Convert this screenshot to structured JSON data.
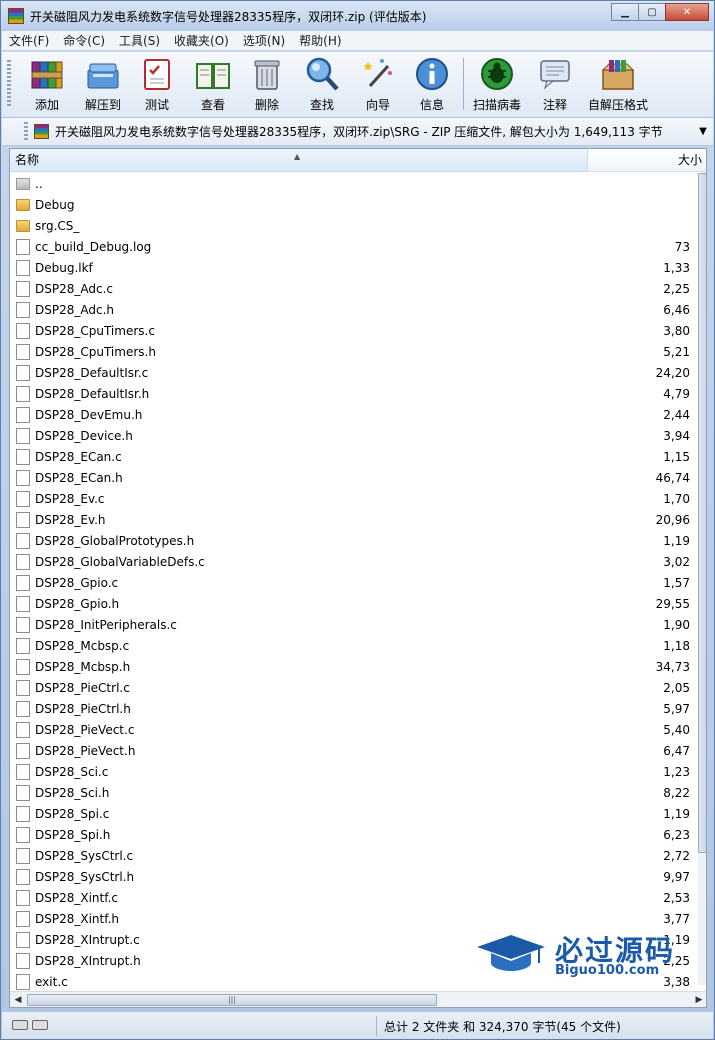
{
  "window": {
    "title": "开关磁阻风力发电系统数字信号处理器28335程序，双闭环.zip (评估版本)",
    "buttons": [
      "▁",
      "▢",
      "✕"
    ]
  },
  "menu": [
    "文件(F)",
    "命令(C)",
    "工具(S)",
    "收藏夹(O)",
    "选项(N)",
    "帮助(H)"
  ],
  "toolbar": [
    {
      "label": "添加",
      "icon": "add-archive-icon"
    },
    {
      "label": "解压到",
      "icon": "extract-to-icon"
    },
    {
      "label": "测试",
      "icon": "test-icon"
    },
    {
      "label": "查看",
      "icon": "view-icon"
    },
    {
      "label": "删除",
      "icon": "trash-icon"
    },
    {
      "label": "查找",
      "icon": "find-icon"
    },
    {
      "label": "向导",
      "icon": "wizard-icon"
    },
    {
      "label": "信息",
      "icon": "info-icon"
    },
    {
      "label": "扫描病毒",
      "icon": "virus-scan-icon"
    },
    {
      "label": "注释",
      "icon": "comment-icon"
    },
    {
      "label": "自解压格式",
      "icon": "sfx-icon"
    }
  ],
  "pathbar": {
    "text": "开关磁阻风力发电系统数字信号处理器28335程序，双闭环.zip\\SRG - ZIP 压缩文件, 解包大小为 1,649,113 字节"
  },
  "columns": {
    "name": "名称",
    "size": "大小"
  },
  "files": [
    {
      "name": "..",
      "size": "",
      "type": "up"
    },
    {
      "name": "Debug",
      "size": "",
      "type": "folder"
    },
    {
      "name": "srg.CS_",
      "size": "",
      "type": "folder"
    },
    {
      "name": "cc_build_Debug.log",
      "size": "73",
      "type": "file"
    },
    {
      "name": "Debug.lkf",
      "size": "1,33",
      "type": "file"
    },
    {
      "name": "DSP28_Adc.c",
      "size": "2,25",
      "type": "file"
    },
    {
      "name": "DSP28_Adc.h",
      "size": "6,46",
      "type": "file"
    },
    {
      "name": "DSP28_CpuTimers.c",
      "size": "3,80",
      "type": "file"
    },
    {
      "name": "DSP28_CpuTimers.h",
      "size": "5,21",
      "type": "file"
    },
    {
      "name": "DSP28_DefaultIsr.c",
      "size": "24,20",
      "type": "file"
    },
    {
      "name": "DSP28_DefaultIsr.h",
      "size": "4,79",
      "type": "file"
    },
    {
      "name": "DSP28_DevEmu.h",
      "size": "2,44",
      "type": "file"
    },
    {
      "name": "DSP28_Device.h",
      "size": "3,94",
      "type": "file"
    },
    {
      "name": "DSP28_ECan.c",
      "size": "1,15",
      "type": "file"
    },
    {
      "name": "DSP28_ECan.h",
      "size": "46,74",
      "type": "file"
    },
    {
      "name": "DSP28_Ev.c",
      "size": "1,70",
      "type": "file"
    },
    {
      "name": "DSP28_Ev.h",
      "size": "20,96",
      "type": "file"
    },
    {
      "name": "DSP28_GlobalPrototypes.h",
      "size": "1,19",
      "type": "file"
    },
    {
      "name": "DSP28_GlobalVariableDefs.c",
      "size": "3,02",
      "type": "file"
    },
    {
      "name": "DSP28_Gpio.c",
      "size": "1,57",
      "type": "file"
    },
    {
      "name": "DSP28_Gpio.h",
      "size": "29,55",
      "type": "file"
    },
    {
      "name": "DSP28_InitPeripherals.c",
      "size": "1,90",
      "type": "file"
    },
    {
      "name": "DSP28_Mcbsp.c",
      "size": "1,18",
      "type": "file"
    },
    {
      "name": "DSP28_Mcbsp.h",
      "size": "34,73",
      "type": "file"
    },
    {
      "name": "DSP28_PieCtrl.c",
      "size": "2,05",
      "type": "file"
    },
    {
      "name": "DSP28_PieCtrl.h",
      "size": "5,97",
      "type": "file"
    },
    {
      "name": "DSP28_PieVect.c",
      "size": "5,40",
      "type": "file"
    },
    {
      "name": "DSP28_PieVect.h",
      "size": "6,47",
      "type": "file"
    },
    {
      "name": "DSP28_Sci.c",
      "size": "1,23",
      "type": "file"
    },
    {
      "name": "DSP28_Sci.h",
      "size": "8,22",
      "type": "file"
    },
    {
      "name": "DSP28_Spi.c",
      "size": "1,19",
      "type": "file"
    },
    {
      "name": "DSP28_Spi.h",
      "size": "6,23",
      "type": "file"
    },
    {
      "name": "DSP28_SysCtrl.c",
      "size": "2,72",
      "type": "file"
    },
    {
      "name": "DSP28_SysCtrl.h",
      "size": "9,97",
      "type": "file"
    },
    {
      "name": "DSP28_Xintf.c",
      "size": "2,53",
      "type": "file"
    },
    {
      "name": "DSP28_Xintf.h",
      "size": "3,77",
      "type": "file"
    },
    {
      "name": "DSP28_XIntrupt.c",
      "size": "1,19",
      "type": "file"
    },
    {
      "name": "DSP28_XIntrupt.h",
      "size": "2,25",
      "type": "file"
    },
    {
      "name": "exit.c",
      "size": "3,38",
      "type": "file"
    }
  ],
  "status": {
    "summary": "总计 2 文件夹 和 324,370 字节(45 个文件)"
  },
  "watermark": {
    "big": "必过源码",
    "small": "Biguo100.com"
  }
}
